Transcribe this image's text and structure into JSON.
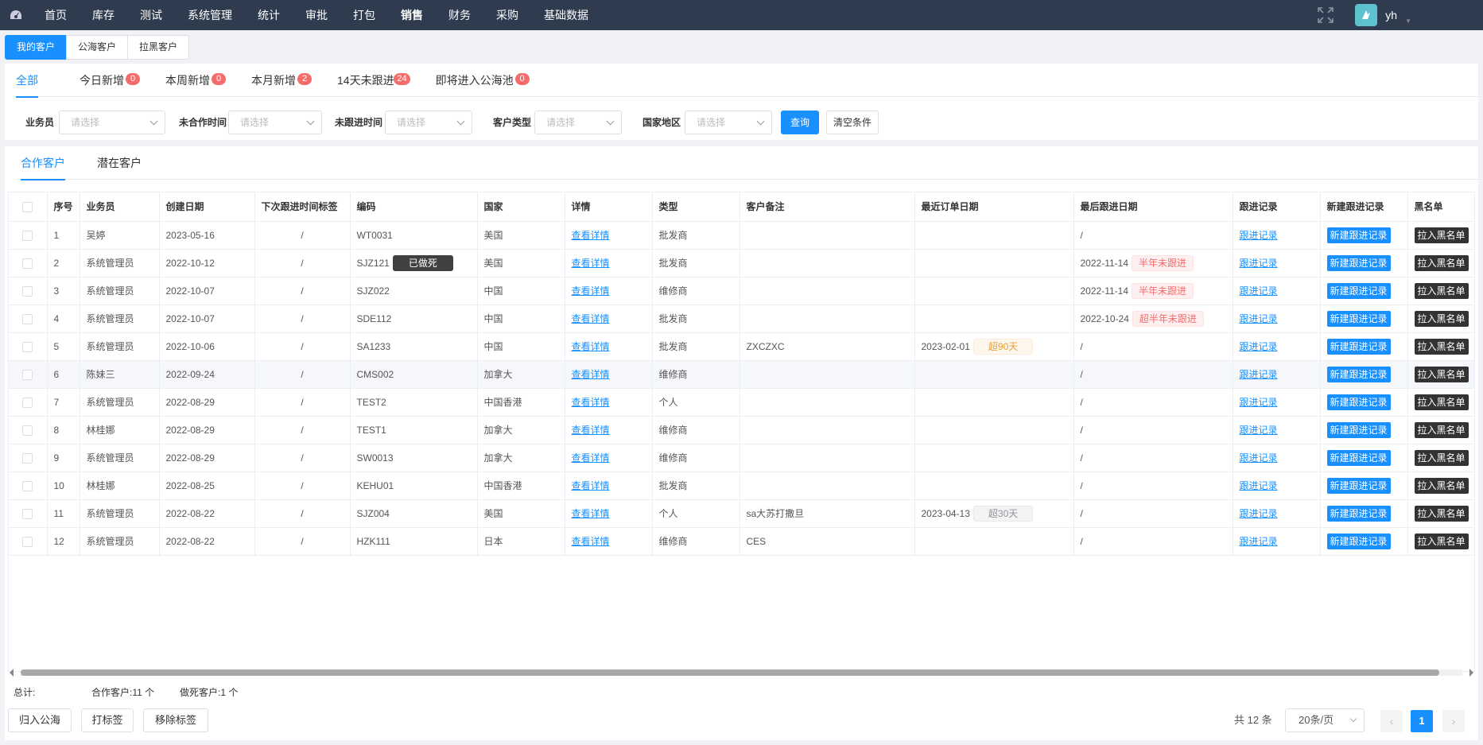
{
  "nav": {
    "items": [
      "首页",
      "库存",
      "测试",
      "系统管理",
      "统计",
      "审批",
      "打包",
      "销售",
      "财务",
      "采购",
      "基础数据"
    ],
    "active_index": 7,
    "username": "yh",
    "logo_icon": "dashboard-icon",
    "fullscreen_icon": "fullscreen-icon"
  },
  "page_tabs": [
    "我的客户",
    "公海客户",
    "拉黑客户"
  ],
  "stat_tabs": [
    {
      "label": "全部",
      "badge": ""
    },
    {
      "label": "今日新增",
      "badge": "0"
    },
    {
      "label": "本周新增",
      "badge": "0"
    },
    {
      "label": "本月新增",
      "badge": "2"
    },
    {
      "label": "14天未跟进",
      "badge": "24"
    },
    {
      "label": "即将进入公海池",
      "badge": "0"
    }
  ],
  "filters": {
    "salesman_label": "业务员",
    "no_coop_label": "未合作时间",
    "no_follow_label": "未跟进时间",
    "customer_type_label": "客户类型",
    "region_label": "国家地区",
    "placeholder": "请选择",
    "query_btn": "查询",
    "clear_btn": "清空条件"
  },
  "sub_tabs": [
    "合作客户",
    "潜在客户"
  ],
  "table": {
    "headers": [
      "序号",
      "业务员",
      "创建日期",
      "下次跟进时间标签",
      "编码",
      "国家",
      "详情",
      "类型",
      "客户备注",
      "最近订单日期",
      "最后跟进日期",
      "跟进记录",
      "新建跟进记录",
      "黑名单"
    ],
    "detail_link": "查看详情",
    "follow_link": "跟进记录",
    "new_follow_btn": "新建跟进记录",
    "blacklist_btn": "拉入黑名单",
    "rows": [
      {
        "no": "1",
        "salesman": "吴婷",
        "created": "2023-05-16",
        "next_tag": "/",
        "code": "WT0031",
        "code_tag": "",
        "country": "美国",
        "type": "批发商",
        "remark": "",
        "last_order": "",
        "order_tag": "",
        "order_tag_style": "",
        "last_follow": "/",
        "follow_tag": "",
        "highlight": false
      },
      {
        "no": "2",
        "salesman": "系统管理员",
        "created": "2022-10-12",
        "next_tag": "/",
        "code": "SJZ121",
        "code_tag": "已做死",
        "country": "美国",
        "type": "批发商",
        "remark": "",
        "last_order": "",
        "order_tag": "",
        "order_tag_style": "",
        "last_follow": "2022-11-14",
        "follow_tag": "半年未跟进",
        "highlight": false
      },
      {
        "no": "3",
        "salesman": "系统管理员",
        "created": "2022-10-07",
        "next_tag": "/",
        "code": "SJZ022",
        "code_tag": "",
        "country": "中国",
        "type": "维修商",
        "remark": "",
        "last_order": "",
        "order_tag": "",
        "order_tag_style": "",
        "last_follow": "2022-11-14",
        "follow_tag": "半年未跟进",
        "highlight": false
      },
      {
        "no": "4",
        "salesman": "系统管理员",
        "created": "2022-10-07",
        "next_tag": "/",
        "code": "SDE112",
        "code_tag": "",
        "country": "中国",
        "type": "批发商",
        "remark": "",
        "last_order": "",
        "order_tag": "",
        "order_tag_style": "",
        "last_follow": "2022-10-24",
        "follow_tag": "超半年未跟进",
        "highlight": false
      },
      {
        "no": "5",
        "salesman": "系统管理员",
        "created": "2022-10-06",
        "next_tag": "/",
        "code": "SA1233",
        "code_tag": "",
        "country": "中国",
        "type": "批发商",
        "remark": "ZXCZXC",
        "last_order": "2023-02-01",
        "order_tag": "超90天",
        "order_tag_style": "orange",
        "last_follow": "/",
        "follow_tag": "",
        "highlight": false
      },
      {
        "no": "6",
        "salesman": "陈妹三",
        "created": "2022-09-24",
        "next_tag": "/",
        "code": "CMS002",
        "code_tag": "",
        "country": "加拿大",
        "type": "维修商",
        "remark": "",
        "last_order": "",
        "order_tag": "",
        "order_tag_style": "",
        "last_follow": "/",
        "follow_tag": "",
        "highlight": true
      },
      {
        "no": "7",
        "salesman": "系统管理员",
        "created": "2022-08-29",
        "next_tag": "/",
        "code": "TEST2",
        "code_tag": "",
        "country": "中国香港",
        "type": "个人",
        "remark": "",
        "last_order": "",
        "order_tag": "",
        "order_tag_style": "",
        "last_follow": "/",
        "follow_tag": "",
        "highlight": false
      },
      {
        "no": "8",
        "salesman": "林桂娜",
        "created": "2022-08-29",
        "next_tag": "/",
        "code": "TEST1",
        "code_tag": "",
        "country": "加拿大",
        "type": "维修商",
        "remark": "",
        "last_order": "",
        "order_tag": "",
        "order_tag_style": "",
        "last_follow": "/",
        "follow_tag": "",
        "highlight": false
      },
      {
        "no": "9",
        "salesman": "系统管理员",
        "created": "2022-08-29",
        "next_tag": "/",
        "code": "SW0013",
        "code_tag": "",
        "country": "加拿大",
        "type": "维修商",
        "remark": "",
        "last_order": "",
        "order_tag": "",
        "order_tag_style": "",
        "last_follow": "/",
        "follow_tag": "",
        "highlight": false
      },
      {
        "no": "10",
        "salesman": "林桂娜",
        "created": "2022-08-25",
        "next_tag": "/",
        "code": "KEHU01",
        "code_tag": "",
        "country": "中国香港",
        "type": "批发商",
        "remark": "",
        "last_order": "",
        "order_tag": "",
        "order_tag_style": "",
        "last_follow": "/",
        "follow_tag": "",
        "highlight": false
      },
      {
        "no": "11",
        "salesman": "系统管理员",
        "created": "2022-08-22",
        "next_tag": "/",
        "code": "SJZ004",
        "code_tag": "",
        "country": "美国",
        "type": "个人",
        "remark": "sa大苏打撒旦",
        "last_order": "2023-04-13",
        "order_tag": "超30天",
        "order_tag_style": "gray",
        "last_follow": "/",
        "follow_tag": "",
        "highlight": false
      },
      {
        "no": "12",
        "salesman": "系统管理员",
        "created": "2022-08-22",
        "next_tag": "/",
        "code": "HZK111",
        "code_tag": "",
        "country": "日本",
        "type": "维修商",
        "remark": "CES",
        "last_order": "",
        "order_tag": "",
        "order_tag_style": "",
        "last_follow": "/",
        "follow_tag": "",
        "highlight": false
      }
    ]
  },
  "summary": {
    "total_label": "总计:",
    "coop_label": "合作客户:11 个",
    "dead_label": "做死客户:1 个"
  },
  "bottom_actions": [
    "归入公海",
    "打标签",
    "移除标签"
  ],
  "pagination": {
    "total_text": "共 12 条",
    "page_size": "20条/页",
    "current_page": "1",
    "prev": "‹",
    "next": "›"
  },
  "colors": {
    "nav_bg": "#2f3c4f",
    "primary": "#1890ff",
    "danger": "#f56c6c"
  }
}
